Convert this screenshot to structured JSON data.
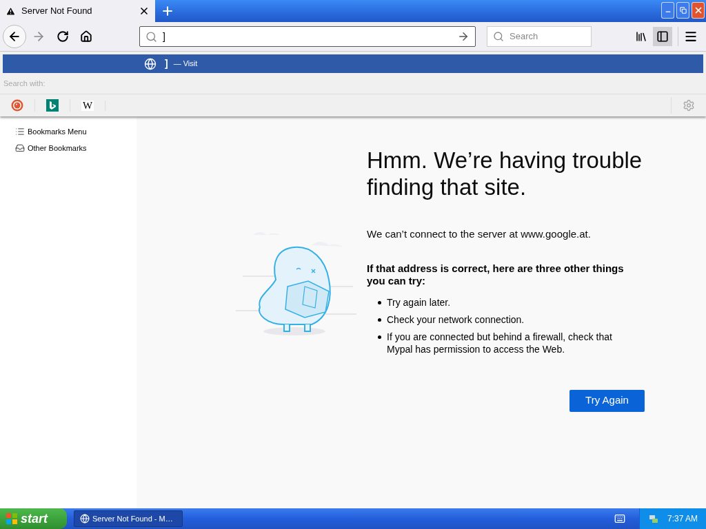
{
  "tab": {
    "title": "Server Not Found"
  },
  "toolbar": {
    "address_value": "]",
    "search_placeholder": "Search",
    "sidebar_open": true
  },
  "suggestion": {
    "value": "]",
    "action": "— Visit"
  },
  "search_with": {
    "label": "Search with:",
    "engines": [
      {
        "kind": "duck"
      },
      {
        "kind": "bing"
      },
      {
        "kind": "wiki",
        "glyph": "W"
      }
    ]
  },
  "sidebar": {
    "items": [
      {
        "label": "Bookmarks Menu",
        "kind": "menu"
      },
      {
        "label": "Other Bookmarks",
        "kind": "other"
      }
    ]
  },
  "error": {
    "title": "Hmm. We’re having trouble finding that site.",
    "message": "We can’t connect to the server at www.google.at.",
    "subtitle": "If that address is correct, here are three other things you can try:",
    "tips": [
      "Try again later.",
      "Check your network connection.",
      "If you are connected but behind a firewall, check that Mypal has permission to access the Web."
    ],
    "button": "Try Again"
  },
  "taskbar": {
    "start": "start",
    "tasks": [
      {
        "label": "Server Not Found - M…",
        "selected": true
      }
    ],
    "time": "7:37 AM"
  }
}
